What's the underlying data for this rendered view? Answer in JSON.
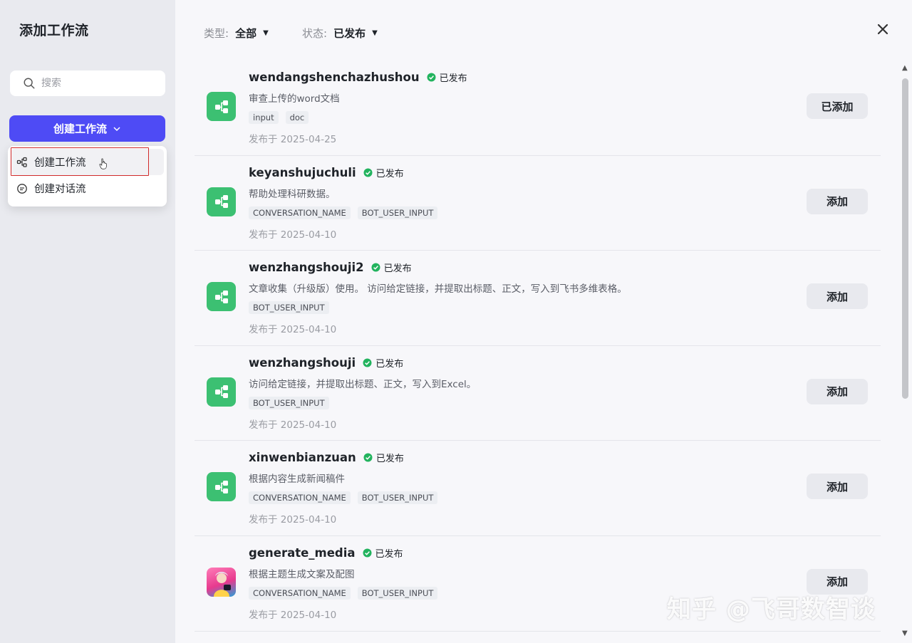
{
  "sidebar": {
    "title": "添加工作流",
    "search_placeholder": "搜索",
    "create_button": "创建工作流",
    "dropdown": [
      {
        "label": "创建工作流"
      },
      {
        "label": "创建对话流"
      }
    ]
  },
  "filters": {
    "type_label": "类型:",
    "type_value": "全部",
    "status_label": "状态:",
    "status_value": "已发布"
  },
  "workflows": [
    {
      "name": "wendangshenchazhushou",
      "status": "已发布",
      "desc": "审查上传的word文档",
      "tags": [
        "input",
        "doc"
      ],
      "date": "发布于 2025-04-25",
      "action": "已添加"
    },
    {
      "name": "keyanshujuchuli",
      "status": "已发布",
      "desc": "帮助处理科研数据。",
      "tags": [
        "CONVERSATION_NAME",
        "BOT_USER_INPUT"
      ],
      "date": "发布于 2025-04-10",
      "action": "添加"
    },
    {
      "name": "wenzhangshouji2",
      "status": "已发布",
      "desc": "文章收集（升级版）使用。 访问给定链接，并提取出标题、正文，写入到飞书多维表格。",
      "tags": [
        "BOT_USER_INPUT"
      ],
      "date": "发布于 2025-04-10",
      "action": "添加"
    },
    {
      "name": "wenzhangshouji",
      "status": "已发布",
      "desc": "访问给定链接，并提取出标题、正文，写入到Excel。",
      "tags": [
        "BOT_USER_INPUT"
      ],
      "date": "发布于 2025-04-10",
      "action": "添加"
    },
    {
      "name": "xinwenbianzuan",
      "status": "已发布",
      "desc": "根据内容生成新闻稿件",
      "tags": [
        "CONVERSATION_NAME",
        "BOT_USER_INPUT"
      ],
      "date": "发布于 2025-04-10",
      "action": "添加"
    },
    {
      "name": "generate_media",
      "status": "已发布",
      "desc": "根据主题生成文案及配图",
      "tags": [
        "CONVERSATION_NAME",
        "BOT_USER_INPUT"
      ],
      "date": "发布于 2025-04-10",
      "action": "添加"
    }
  ],
  "watermark": "知乎 @飞哥数智谈",
  "colors": {
    "primary": "#4e4bf5",
    "status_green": "#22b35e",
    "workflow_icon": "#3cc072"
  }
}
